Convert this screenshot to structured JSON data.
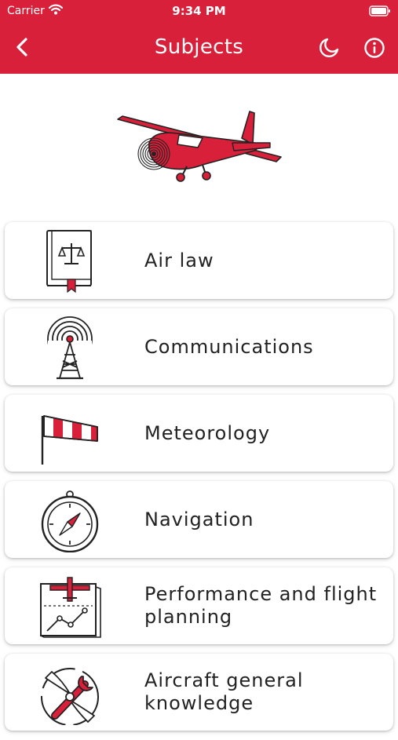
{
  "status": {
    "carrier": "Carrier",
    "time": "9:34 PM"
  },
  "navbar": {
    "title": "Subjects"
  },
  "icons": {
    "back": "chevron-left-icon",
    "theme": "moon-icon",
    "info": "info-icon",
    "hero": "airplane-icon"
  },
  "colors": {
    "accent": "#d8203a",
    "text": "#222222",
    "card": "#ffffff"
  },
  "subjects": [
    {
      "label": "Air law",
      "icon": "law-book-icon"
    },
    {
      "label": "Communications",
      "icon": "radio-tower-icon"
    },
    {
      "label": "Meteorology",
      "icon": "windsock-icon"
    },
    {
      "label": "Navigation",
      "icon": "compass-icon"
    },
    {
      "label": "Performance and flight planning",
      "icon": "flight-chart-icon"
    },
    {
      "label": "Aircraft general knowledge",
      "icon": "propeller-wrench-icon"
    }
  ]
}
